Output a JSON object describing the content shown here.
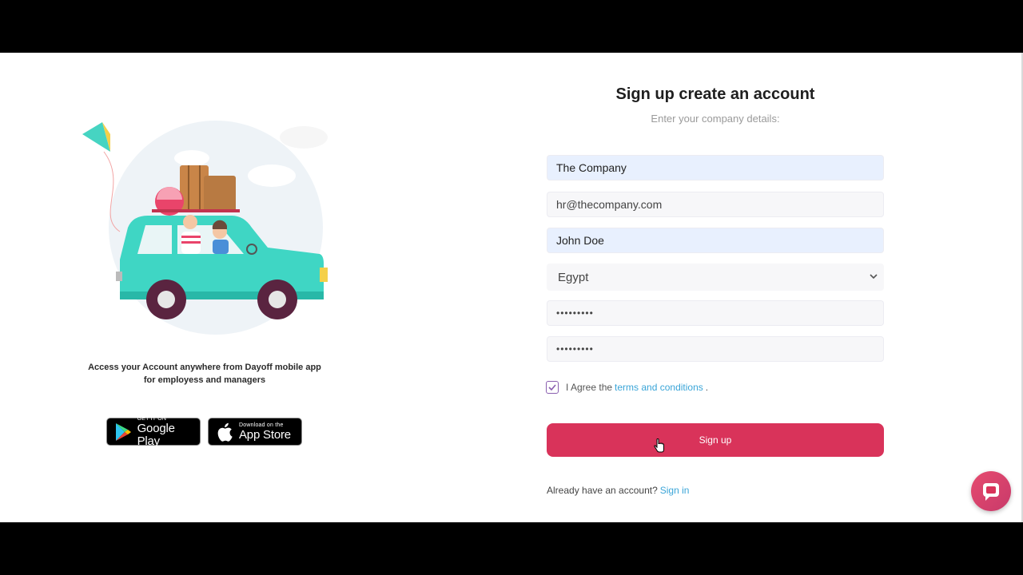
{
  "illustration": {
    "name": "car-travel-illustration"
  },
  "promo": {
    "line1": "Access your Account anywhere from Dayoff mobile app",
    "line2": "for employess and managers"
  },
  "stores": {
    "google": {
      "small": "GET IT ON",
      "big": "Google Play"
    },
    "apple": {
      "small": "Download on the",
      "big": "App Store"
    }
  },
  "form": {
    "title": "Sign up create an account",
    "subtitle": "Enter your company details:",
    "company": "The Company",
    "email": "hr@thecompany.com",
    "name": "John Doe",
    "country": "Egypt",
    "password": "•••••••••",
    "confirm_password": "•••••••••",
    "agree_prefix": "I Agree the",
    "terms_link": "terms and conditions",
    "agree_suffix": ".",
    "agree_checked": true,
    "submit": "Sign up",
    "have_account": "Already have an account?",
    "signin_link": "Sign in"
  },
  "colors": {
    "accent": "#d9335a",
    "link": "#3aa5d8",
    "checkbox": "#8a5fb0"
  },
  "icons": [
    "google-play-icon",
    "apple-icon",
    "chevron-down-icon",
    "check-icon",
    "cursor-icon",
    "chat-icon"
  ]
}
